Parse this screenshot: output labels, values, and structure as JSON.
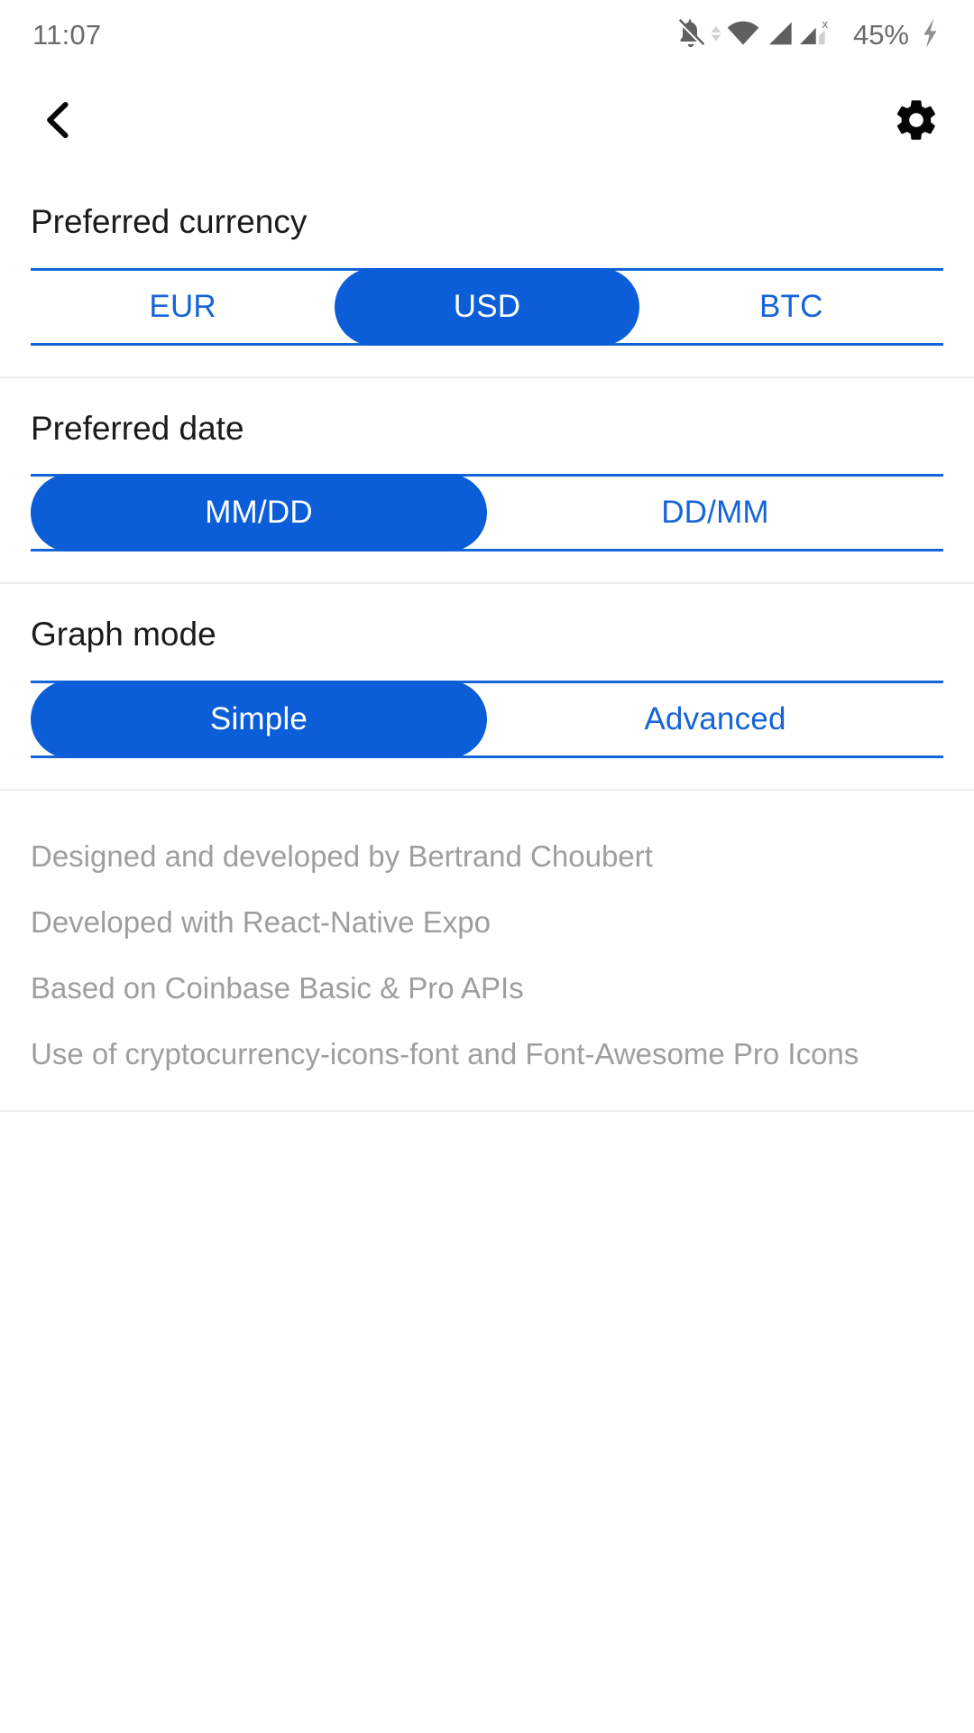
{
  "status_bar": {
    "time": "11:07",
    "battery_percent": "45%",
    "icons": [
      "bell-off-icon",
      "wifi-icon",
      "signal-bars-icon",
      "signal-bars-x-icon",
      "charging-bolt-icon"
    ]
  },
  "nav_bar": {
    "back_icon": "chevron-left-icon",
    "settings_icon": "gear-icon"
  },
  "colors": {
    "accent_blue": "#0b5ed7",
    "border_blue": "#1565d8",
    "label_text": "#1b1b1b",
    "credit_text": "#9e9e9e",
    "status_text": "#6b6b6b",
    "divider": "#eeeeee"
  },
  "sections": [
    {
      "label": "Preferred currency",
      "options": [
        {
          "label": "EUR",
          "selected": false
        },
        {
          "label": "USD",
          "selected": true
        },
        {
          "label": "BTC",
          "selected": false
        }
      ]
    },
    {
      "label": "Preferred date",
      "options": [
        {
          "label": "MM/DD",
          "selected": true
        },
        {
          "label": "DD/MM",
          "selected": false
        }
      ]
    },
    {
      "label": "Graph mode",
      "options": [
        {
          "label": "Simple",
          "selected": true
        },
        {
          "label": "Advanced",
          "selected": false
        }
      ]
    }
  ],
  "credits": [
    "Designed and developed by Bertrand Choubert",
    "Developed with React-Native Expo",
    "Based on Coinbase Basic & Pro APIs",
    "Use of cryptocurrency-icons-font and Font-Awesome Pro Icons"
  ]
}
